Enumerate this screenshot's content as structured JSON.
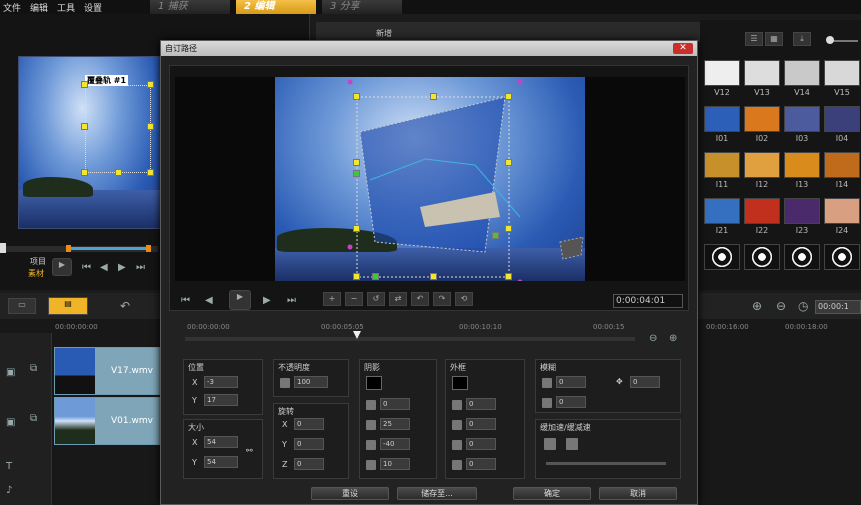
{
  "menu": [
    "文件",
    "编辑",
    "工具",
    "设置"
  ],
  "steps": [
    {
      "num": "1",
      "label": "捕获"
    },
    {
      "num": "2",
      "label": "编辑"
    },
    {
      "num": "3",
      "label": "分享"
    }
  ],
  "left_preview": {
    "track_label": "覆叠轨 #1",
    "project_label": "项目",
    "clip_label": "素材"
  },
  "library": {
    "thumb_labels": [
      "V12",
      "V13",
      "V14",
      "V15",
      "I01",
      "I02",
      "I03",
      "I04",
      "I11",
      "I12",
      "I13",
      "I14",
      "I21",
      "I22",
      "I23",
      "I24"
    ],
    "new_label": "新增"
  },
  "timeline": {
    "ruler": [
      "00:00:00:00",
      "00:00:16:00",
      "00:00:18:00",
      "00:00:1"
    ],
    "clips": [
      "V17.wmv",
      "V01.wmv"
    ]
  },
  "dialog": {
    "title": "自订路径",
    "close": "✕",
    "timecode": "0:00:04:01",
    "ruler": [
      "00:00:00:00",
      "00:00:05:05",
      "00:00:10:10",
      "00:00:15"
    ],
    "position": {
      "label": "位置",
      "x": "-3",
      "y": "17"
    },
    "size": {
      "label": "大小",
      "x": "54",
      "y": "54"
    },
    "opacity": {
      "label": "不透明度",
      "value": "100"
    },
    "rotation": {
      "label": "旋转",
      "x": "0",
      "y": "0",
      "z": "0"
    },
    "shadow": {
      "label": "阴影",
      "v1": "0",
      "v2": "25",
      "v3": "-40",
      "v4": "10"
    },
    "border": {
      "label": "外框",
      "v1": "0",
      "v2": "0",
      "v3": "0",
      "v4": "0"
    },
    "blur": {
      "label": "模糊",
      "v1": "0",
      "v2": "0",
      "v3": "0"
    },
    "easing": {
      "label": "缓加速/缓减速"
    },
    "buttons": [
      "重设",
      "储存至...",
      "确定",
      "取消"
    ]
  },
  "colors": {
    "accent": "#f0b429",
    "clip": "#7fa6b8",
    "handle_yellow": "#f4e531",
    "handle_green": "#3fc63a"
  }
}
